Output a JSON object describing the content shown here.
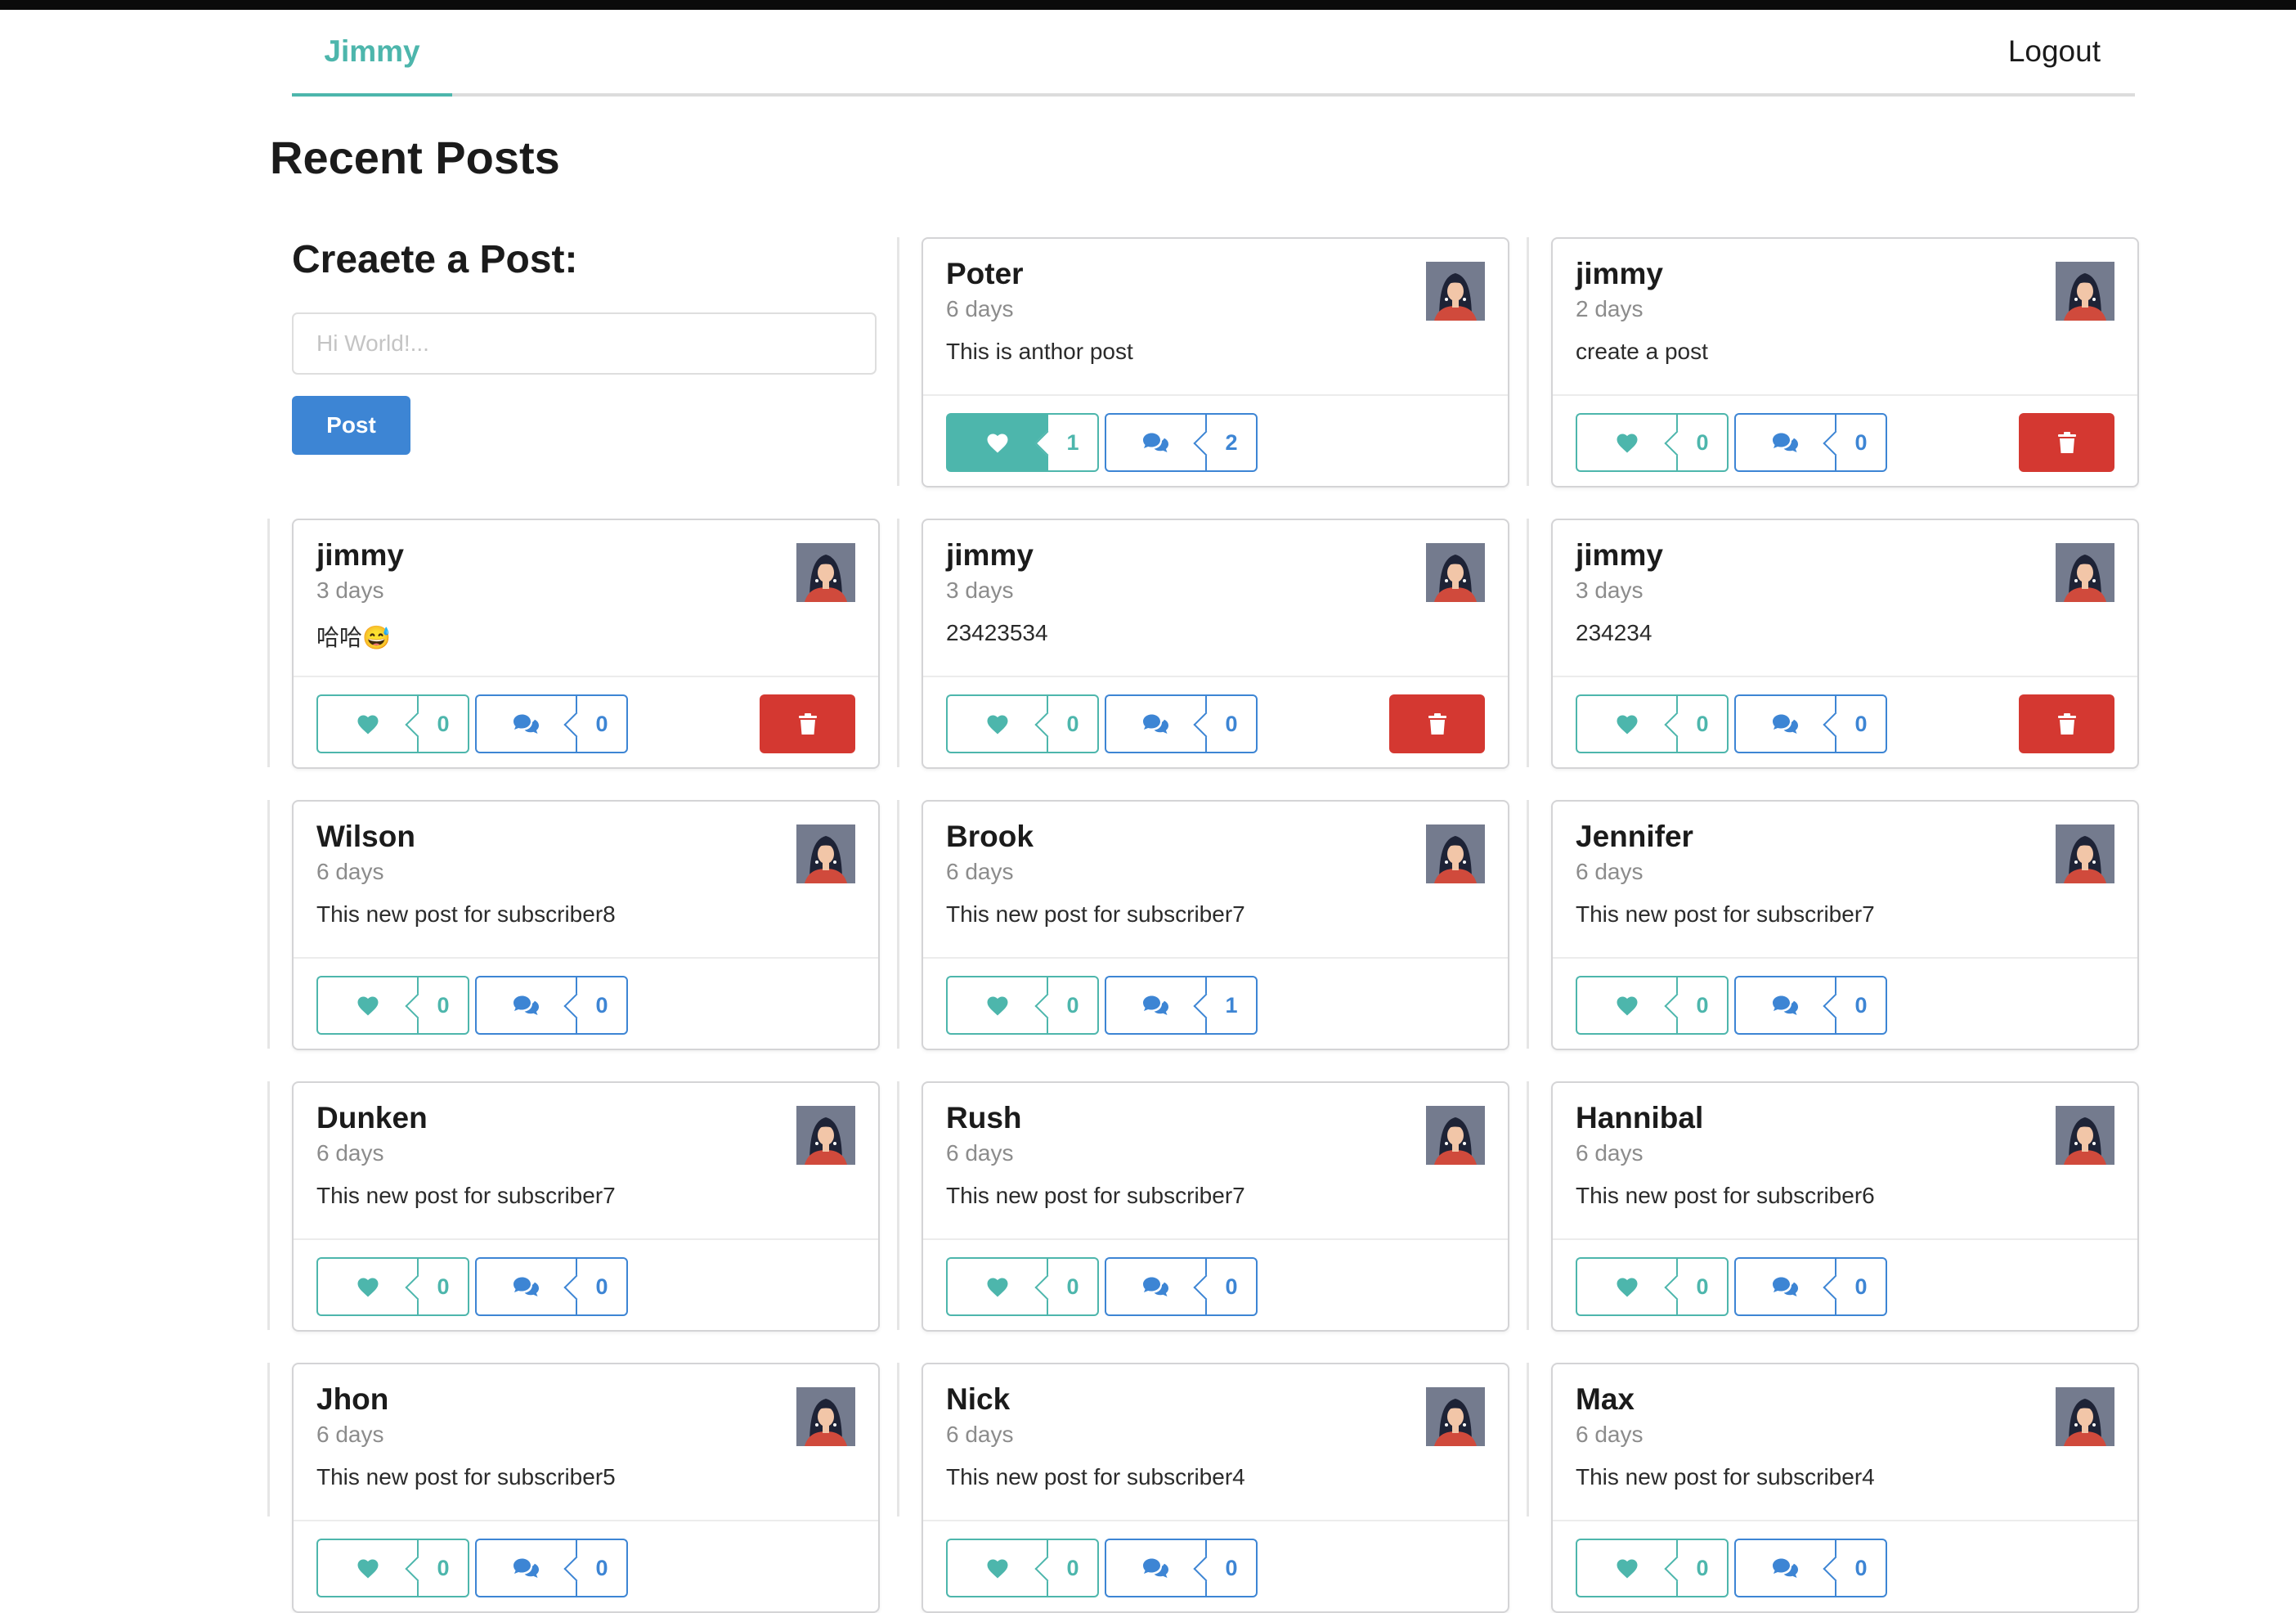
{
  "menu": {
    "brand": "Jimmy",
    "logout": "Logout"
  },
  "page": {
    "title": "Recent Posts"
  },
  "create_post": {
    "title": "Creaete a Post:",
    "placeholder": "Hi World!...",
    "button": "Post"
  },
  "colors": {
    "teal": "#4db6ac",
    "blue": "#3d85d4",
    "red": "#d43831"
  },
  "icons": {
    "like": "heart-icon",
    "comment": "comments-icon",
    "delete": "trash-icon",
    "avatar": "avatar-image"
  },
  "posts": [
    {
      "name": "Poter",
      "time": "6 days",
      "text": "This is anthor post",
      "likes": "1",
      "comments": "2",
      "liked": true,
      "deletable": false
    },
    {
      "name": "jimmy",
      "time": "2 days",
      "text": "create a post",
      "likes": "0",
      "comments": "0",
      "liked": false,
      "deletable": true
    },
    {
      "name": "jimmy",
      "time": "3 days",
      "text": "哈哈😅",
      "likes": "0",
      "comments": "0",
      "liked": false,
      "deletable": true
    },
    {
      "name": "jimmy",
      "time": "3 days",
      "text": "23423534",
      "likes": "0",
      "comments": "0",
      "liked": false,
      "deletable": true
    },
    {
      "name": "jimmy",
      "time": "3 days",
      "text": "234234",
      "likes": "0",
      "comments": "0",
      "liked": false,
      "deletable": true
    },
    {
      "name": "Wilson",
      "time": "6 days",
      "text": "This new post for subscriber8",
      "likes": "0",
      "comments": "0",
      "liked": false,
      "deletable": false
    },
    {
      "name": "Brook",
      "time": "6 days",
      "text": "This new post for subscriber7",
      "likes": "0",
      "comments": "1",
      "liked": false,
      "deletable": false
    },
    {
      "name": "Jennifer",
      "time": "6 days",
      "text": "This new post for subscriber7",
      "likes": "0",
      "comments": "0",
      "liked": false,
      "deletable": false
    },
    {
      "name": "Dunken",
      "time": "6 days",
      "text": "This new post for subscriber7",
      "likes": "0",
      "comments": "0",
      "liked": false,
      "deletable": false
    },
    {
      "name": "Rush",
      "time": "6 days",
      "text": "This new post for subscriber7",
      "likes": "0",
      "comments": "0",
      "liked": false,
      "deletable": false
    },
    {
      "name": "Hannibal",
      "time": "6 days",
      "text": "This new post for subscriber6",
      "likes": "0",
      "comments": "0",
      "liked": false,
      "deletable": false
    },
    {
      "name": "Jhon",
      "time": "6 days",
      "text": "This new post for subscriber5",
      "likes": "0",
      "comments": "0",
      "liked": false,
      "deletable": false
    },
    {
      "name": "Nick",
      "time": "6 days",
      "text": "This new post for subscriber4",
      "likes": "0",
      "comments": "0",
      "liked": false,
      "deletable": false
    },
    {
      "name": "Max",
      "time": "6 days",
      "text": "This new post for subscriber4",
      "likes": "0",
      "comments": "0",
      "liked": false,
      "deletable": false
    }
  ]
}
